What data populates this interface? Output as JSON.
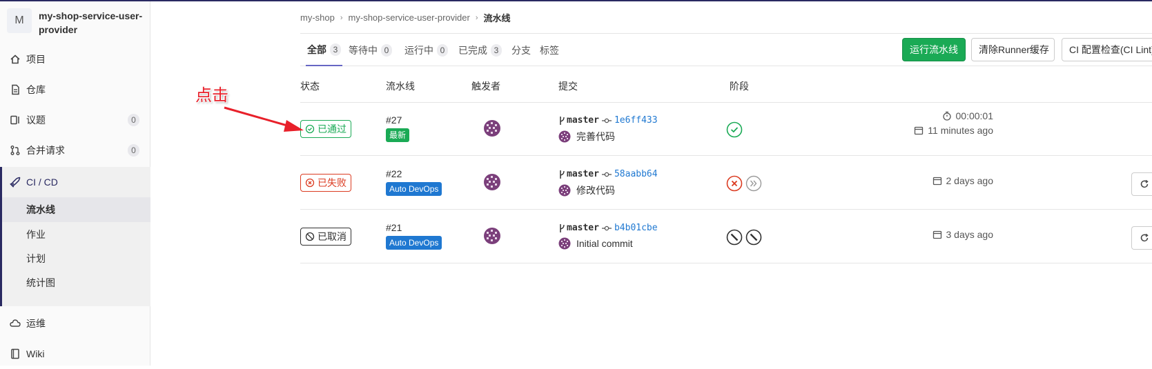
{
  "sidebar": {
    "project_initial": "M",
    "project_name": "my-shop-service-user-provider",
    "items": [
      {
        "label": "项目",
        "icon": "home-icon"
      },
      {
        "label": "仓库",
        "icon": "document-icon"
      },
      {
        "label": "议题",
        "icon": "issues-icon",
        "count": "0"
      },
      {
        "label": "合并请求",
        "icon": "merge-request-icon",
        "count": "0"
      },
      {
        "label": "CI / CD",
        "icon": "rocket-icon"
      },
      {
        "label": "运维",
        "icon": "cloud-icon"
      },
      {
        "label": "Wiki",
        "icon": "book-icon"
      }
    ],
    "cicd_sub": [
      "流水线",
      "作业",
      "计划",
      "统计图"
    ]
  },
  "breadcrumb": [
    "my-shop",
    "my-shop-service-user-provider",
    "流水线"
  ],
  "tabs": [
    {
      "label": "全部",
      "count": "3"
    },
    {
      "label": "等待中",
      "count": "0"
    },
    {
      "label": "运行中",
      "count": "0"
    },
    {
      "label": "已完成",
      "count": "3"
    },
    {
      "label": "分支"
    },
    {
      "label": "标签"
    }
  ],
  "buttons": {
    "run": "运行流水线",
    "clear_cache": "清除Runner缓存",
    "ci_lint": "CI 配置检查(CI Lint)"
  },
  "table": {
    "headers": [
      "状态",
      "流水线",
      "触发者",
      "提交",
      "阶段"
    ],
    "rows": [
      {
        "status": "已通过",
        "status_type": "passed",
        "id": "#27",
        "tag": "最新",
        "branch": "master",
        "sha": "1e6ff433",
        "message": "完善代码",
        "stages": [
          "success"
        ],
        "duration": "00:00:01",
        "finished": "11 minutes ago"
      },
      {
        "status": "已失败",
        "status_type": "failed",
        "id": "#22",
        "tag": "Auto DevOps",
        "branch": "master",
        "sha": "58aabb64",
        "message": "修改代码",
        "stages": [
          "failed",
          "skipped"
        ],
        "finished": "2 days ago"
      },
      {
        "status": "已取消",
        "status_type": "canceled",
        "id": "#21",
        "tag": "Auto DevOps",
        "branch": "master",
        "sha": "b4b01cbe",
        "message": "Initial commit",
        "stages": [
          "canceled",
          "canceled"
        ],
        "finished": "3 days ago"
      }
    ]
  },
  "annotation": {
    "text": "点击",
    "color": "#e8202a"
  },
  "colors": {
    "success": "#1aaa55",
    "failed": "#db3b21",
    "link": "#1f78d1",
    "accent": "#292961"
  }
}
